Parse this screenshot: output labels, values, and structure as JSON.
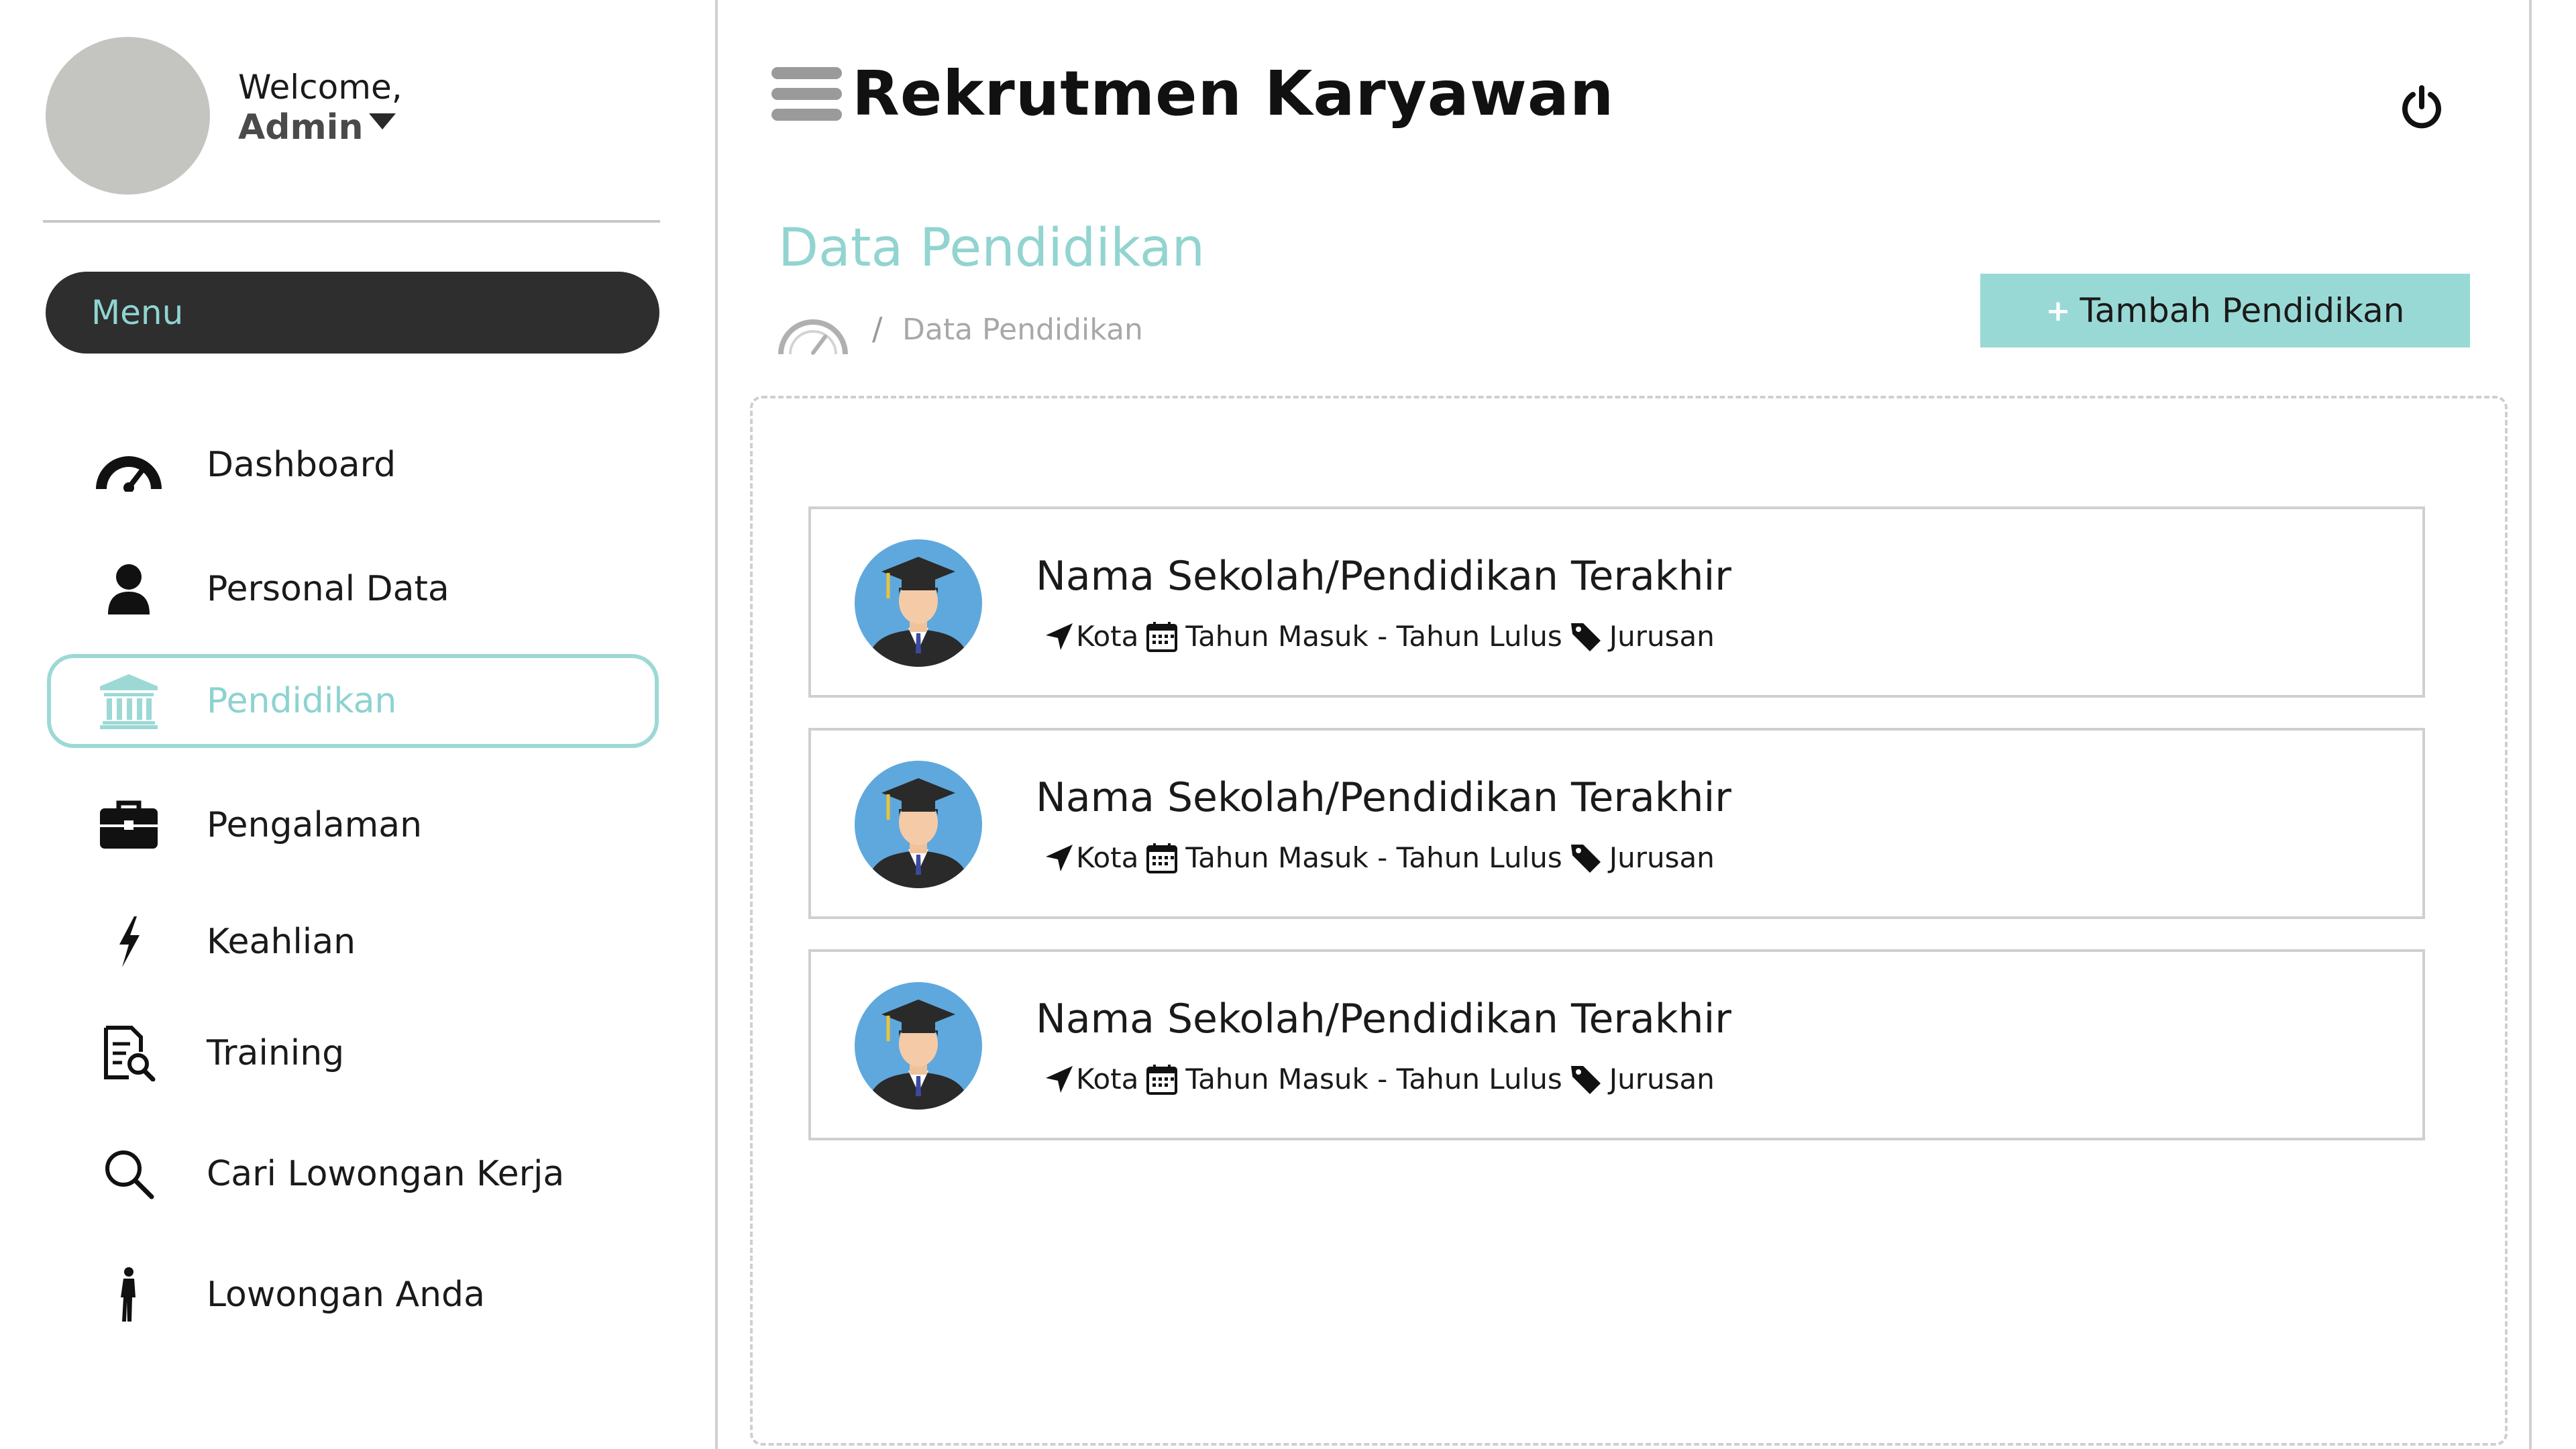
{
  "user": {
    "welcome": "Welcome,",
    "name": "Admin"
  },
  "sidebar": {
    "menu_label": "Menu",
    "items": [
      {
        "label": "Dashboard",
        "icon": "dashboard-gauge-icon"
      },
      {
        "label": "Personal Data",
        "icon": "user-icon"
      },
      {
        "label": "Pendidikan",
        "icon": "institution-icon",
        "active": true
      },
      {
        "label": "Pengalaman",
        "icon": "briefcase-icon"
      },
      {
        "label": "Keahlian",
        "icon": "bolt-icon"
      },
      {
        "label": "Training",
        "icon": "document-search-icon"
      },
      {
        "label": "Cari Lowongan Kerja",
        "icon": "search-icon"
      },
      {
        "label": "Lowongan Anda",
        "icon": "person-walking-icon"
      }
    ]
  },
  "header": {
    "title": "Rekrutmen Karyawan"
  },
  "page": {
    "title": "Data Pendidikan",
    "breadcrumb": {
      "separator": "/",
      "current": "Data Pendidikan"
    },
    "add_button": {
      "plus": "+",
      "label": "Tambah Pendidikan"
    }
  },
  "education": [
    {
      "school": "Nama Sekolah/Pendidikan Terakhir",
      "city": "Kota",
      "years": "Tahun Masuk - Tahun Lulus",
      "major": "Jurusan"
    },
    {
      "school": "Nama Sekolah/Pendidikan Terakhir",
      "city": "Kota",
      "years": "Tahun Masuk - Tahun Lulus",
      "major": "Jurusan"
    },
    {
      "school": "Nama Sekolah/Pendidikan Terakhir",
      "city": "Kota",
      "years": "Tahun Masuk - Tahun Lulus",
      "major": "Jurusan"
    }
  ],
  "colors": {
    "accent": "#99d9d5",
    "accent_text": "#8dd3cf",
    "menu_bg": "#2e2e2e",
    "avatar": "#c4c4c1",
    "border": "#cfcfcf"
  }
}
